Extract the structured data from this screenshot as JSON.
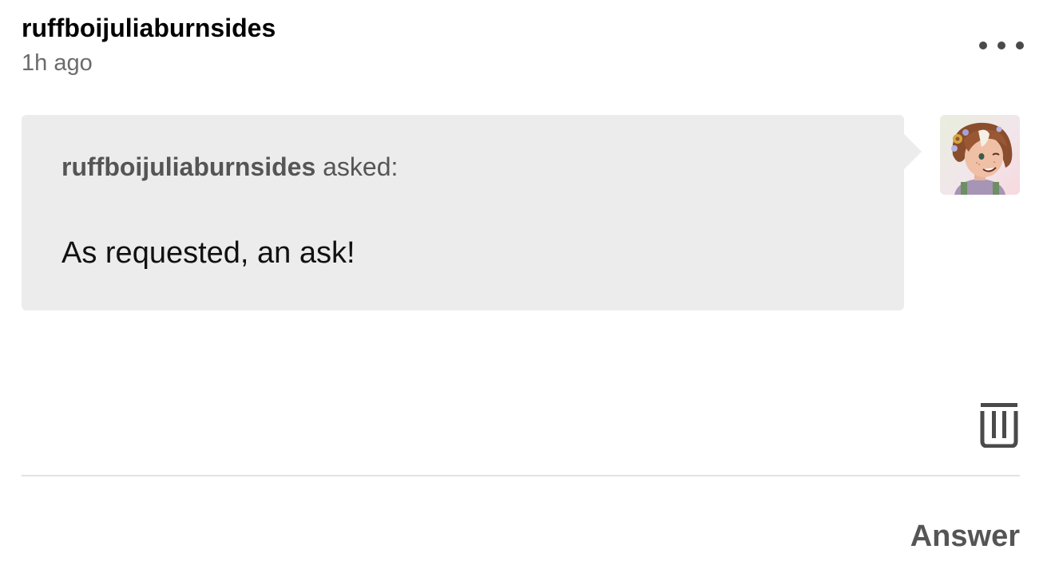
{
  "post": {
    "username": "ruffboijuliaburnsides",
    "timestamp": "1h ago",
    "more_icon": "ellipsis-icon"
  },
  "ask": {
    "asker": "ruffboijuliaburnsides",
    "asked_suffix": " asked:",
    "question": "As requested, an ask!",
    "bubble_color": "#ececec"
  },
  "avatar": {
    "icon": "avatar-illustration"
  },
  "actions": {
    "delete_icon": "trash-icon",
    "answer_label": "Answer"
  },
  "colors": {
    "text_primary": "#000000",
    "text_muted": "#6b6b6b",
    "text_secondary": "#555555",
    "divider": "#e2e2e2"
  }
}
